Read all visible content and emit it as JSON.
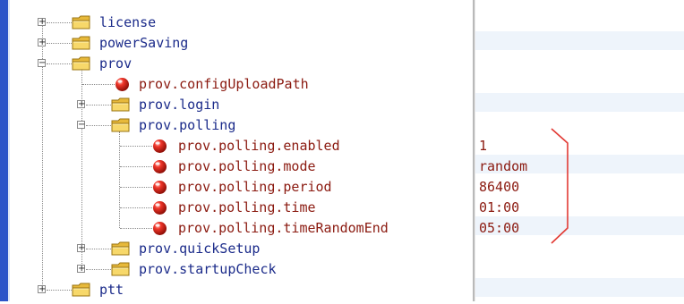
{
  "icons": {
    "folder": "folder-icon",
    "leaf": "red-ball-icon",
    "expand": "+",
    "collapse": "−"
  },
  "colors": {
    "folder_text": "#1b2b8a",
    "leaf_text": "#8b1a10",
    "bracket": "#e23a34",
    "left_bar": "#2d54c8"
  },
  "tree": [
    {
      "label": "license",
      "kind": "folder",
      "level": 0,
      "toggle": "expand",
      "value": ""
    },
    {
      "label": "powerSaving",
      "kind": "folder",
      "level": 0,
      "toggle": "expand",
      "value": ""
    },
    {
      "label": "prov",
      "kind": "folder",
      "level": 0,
      "toggle": "collapse",
      "value": ""
    },
    {
      "label": "prov.configUploadPath",
      "kind": "leaf",
      "level": 1,
      "toggle": "",
      "value": ""
    },
    {
      "label": "prov.login",
      "kind": "folder",
      "level": 1,
      "toggle": "expand",
      "value": ""
    },
    {
      "label": "prov.polling",
      "kind": "folder",
      "level": 1,
      "toggle": "collapse",
      "value": ""
    },
    {
      "label": "prov.polling.enabled",
      "kind": "leaf",
      "level": 2,
      "toggle": "",
      "value": "1"
    },
    {
      "label": "prov.polling.mode",
      "kind": "leaf",
      "level": 2,
      "toggle": "",
      "value": "random"
    },
    {
      "label": "prov.polling.period",
      "kind": "leaf",
      "level": 2,
      "toggle": "",
      "value": "86400"
    },
    {
      "label": "prov.polling.time",
      "kind": "leaf",
      "level": 2,
      "toggle": "",
      "value": "01:00"
    },
    {
      "label": "prov.polling.timeRandomEnd",
      "kind": "leaf",
      "level": 2,
      "toggle": "",
      "value": "05:00"
    },
    {
      "label": "prov.quickSetup",
      "kind": "folder",
      "level": 1,
      "toggle": "expand",
      "value": ""
    },
    {
      "label": "prov.startupCheck",
      "kind": "folder",
      "level": 1,
      "toggle": "expand",
      "value": ""
    },
    {
      "label": "ptt",
      "kind": "folder",
      "level": 0,
      "toggle": "expand",
      "value": ""
    }
  ]
}
